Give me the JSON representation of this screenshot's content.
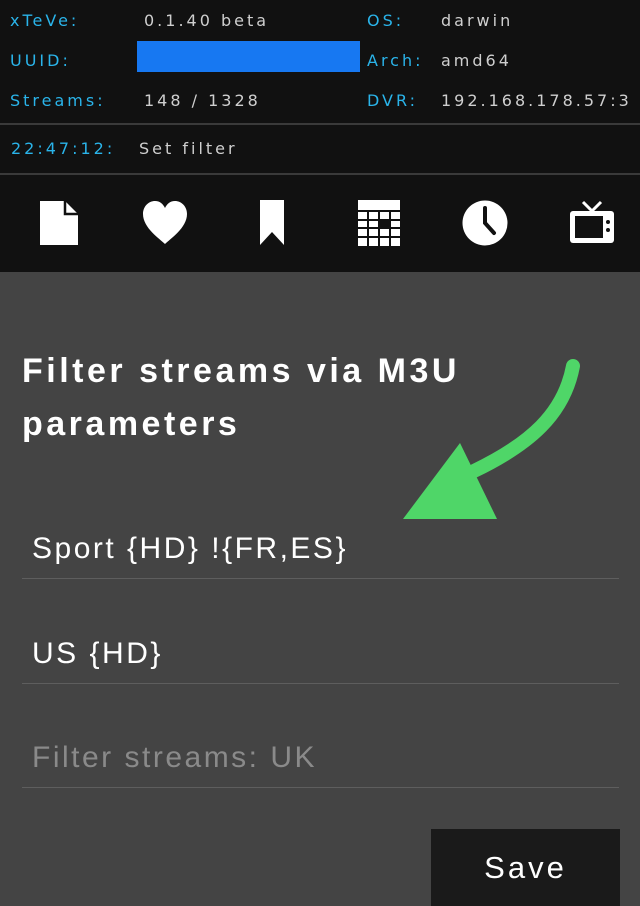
{
  "header": {
    "rows": [
      {
        "left_label": "xTeVe:",
        "left_value": "0.1.40 beta",
        "right_label": "OS:",
        "right_value": "darwin"
      },
      {
        "left_label": "UUID:",
        "left_value": "",
        "right_label": "Arch:",
        "right_value": "amd64"
      },
      {
        "left_label": "Streams:",
        "left_value": "148 / 1328",
        "right_label": "DVR:",
        "right_value": "192.168.178.57:3"
      }
    ],
    "uuid_redaction_color": "#1778f2"
  },
  "status": {
    "time": "22:47:12:",
    "message": "Set filter"
  },
  "nav": {
    "icons": [
      "file-icon",
      "heart-icon",
      "bookmark-icon",
      "grid-icon",
      "clock-icon",
      "tv-icon"
    ]
  },
  "main": {
    "title": "Filter streams via M3U parameters",
    "filters": [
      {
        "value": "Sport {HD} !{FR,ES}",
        "placeholder": ""
      },
      {
        "value": "US {HD}",
        "placeholder": ""
      },
      {
        "value": "",
        "placeholder": "Filter streams: UK"
      }
    ],
    "save_label": "Save"
  },
  "colors": {
    "label": "#2ab4ea",
    "value": "#cfcfcf",
    "header_bg": "#111111",
    "page_bg": "#444444",
    "arrow": "#4fd668"
  }
}
